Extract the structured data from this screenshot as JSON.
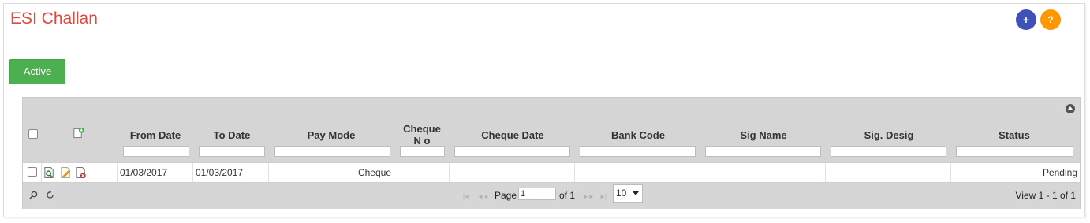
{
  "header": {
    "title": "ESI Challan",
    "add_button": "+",
    "help_button": "?"
  },
  "toolbar": {
    "active_button": "Active"
  },
  "grid": {
    "columns": [
      {
        "key": "from_date",
        "label": "From Date"
      },
      {
        "key": "to_date",
        "label": "To Date"
      },
      {
        "key": "pay_mode",
        "label": "Pay Mode"
      },
      {
        "key": "cheque_no",
        "label": "Cheque N o"
      },
      {
        "key": "cheque_date",
        "label": "Cheque Date"
      },
      {
        "key": "bank_code",
        "label": "Bank Code"
      },
      {
        "key": "sig_name",
        "label": "Sig Name"
      },
      {
        "key": "sig_desig",
        "label": "Sig. Desig"
      },
      {
        "key": "status",
        "label": "Status"
      }
    ],
    "rows": [
      {
        "from_date": "01/03/2017",
        "to_date": "01/03/2017",
        "pay_mode": "Cheque",
        "cheque_no": "",
        "cheque_date": "",
        "bank_code": "",
        "sig_name": "",
        "sig_desig": "",
        "status": "Pending"
      }
    ],
    "icons": {
      "header_add": "add-record-icon",
      "row_view": "view-record-icon",
      "row_edit": "edit-record-icon",
      "row_delete": "delete-record-icon"
    }
  },
  "pager": {
    "page_label": "Page",
    "page_value": "1",
    "of_label": "of 1",
    "rows_per_page": "10",
    "view_text": "View 1 - 1 of 1"
  },
  "colors": {
    "title": "#e2483d",
    "add_button": "#3f51b5",
    "help_button": "#ff9800",
    "active_button": "#4caf50"
  }
}
